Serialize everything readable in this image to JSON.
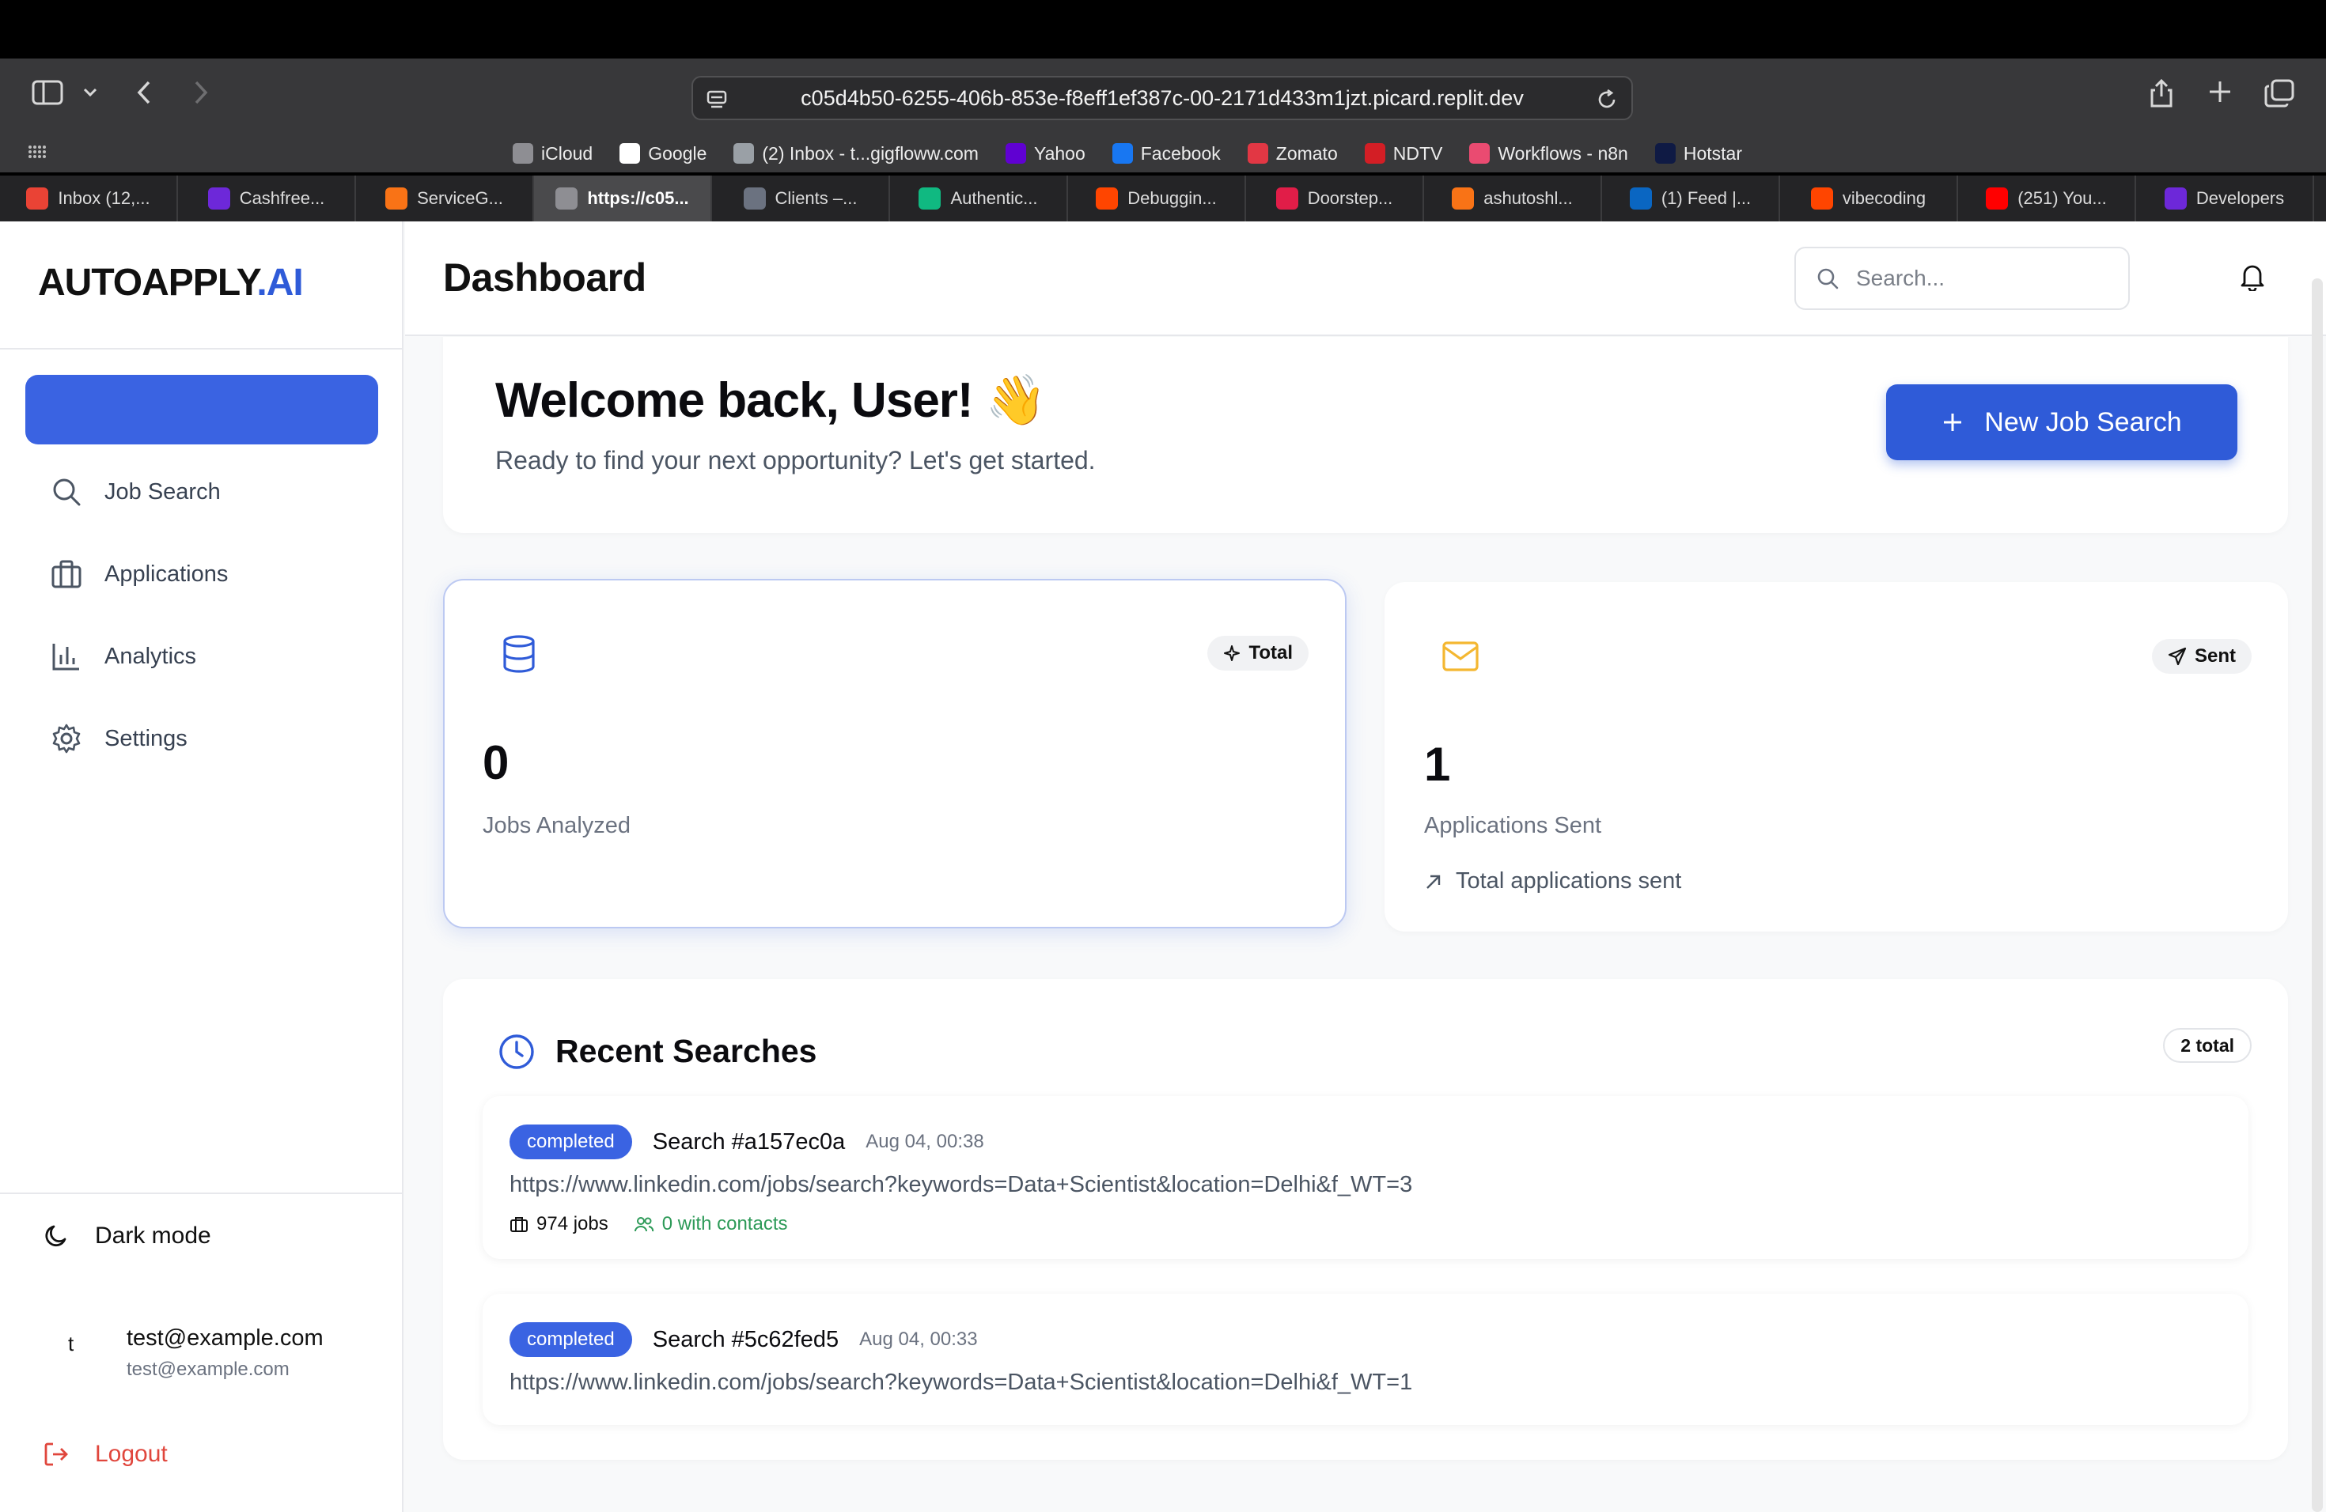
{
  "browser": {
    "url": "c05d4b50-6255-406b-853e-f8eff1ef387c-00-2171d433m1jzt.picard.replit.dev",
    "favorites": [
      {
        "label": "iCloud",
        "icon": "apple-icon",
        "color": "#8e8e93"
      },
      {
        "label": "Google",
        "icon": "google-icon",
        "color": "#ffffff"
      },
      {
        "label": "(2) Inbox - t...gigfloww.com",
        "icon": "chat-icon",
        "color": "#9aa0a6"
      },
      {
        "label": "Yahoo",
        "icon": "yahoo-icon",
        "color": "#6001d2"
      },
      {
        "label": "Facebook",
        "icon": "facebook-icon",
        "color": "#1877f2"
      },
      {
        "label": "Zomato",
        "icon": "zomato-icon",
        "color": "#e23744"
      },
      {
        "label": "NDTV",
        "icon": "ndtv-icon",
        "color": "#d31e25"
      },
      {
        "label": "Workflows - n8n",
        "icon": "n8n-icon",
        "color": "#ea4b71"
      },
      {
        "label": "Hotstar",
        "icon": "hotstar-icon",
        "color": "#0f1a44"
      }
    ],
    "tabs": [
      {
        "label": "Inbox (12,...",
        "icon": "gmail-icon",
        "color": "#ea4335",
        "active": false
      },
      {
        "label": "Cashfree...",
        "icon": "cashfree-icon",
        "color": "#6d28d9",
        "active": false
      },
      {
        "label": "ServiceG...",
        "icon": "servicegen-icon",
        "color": "#f97316",
        "active": false
      },
      {
        "label": "https://c05...",
        "icon": "replit-icon",
        "color": "#8e8e93",
        "active": true
      },
      {
        "label": "Clients –...",
        "icon": "clients-icon",
        "color": "#6b7280",
        "active": false
      },
      {
        "label": "Authentic...",
        "icon": "auth-icon",
        "color": "#10b981",
        "active": false
      },
      {
        "label": "Debuggin...",
        "icon": "reddit-icon",
        "color": "#ff4500",
        "active": false
      },
      {
        "label": "Doorstep...",
        "icon": "doorstep-icon",
        "color": "#e11d48",
        "active": false
      },
      {
        "label": "ashutoshl...",
        "icon": "servicegen-icon",
        "color": "#f97316",
        "active": false
      },
      {
        "label": "(1) Feed |...",
        "icon": "linkedin-icon",
        "color": "#0a66c2",
        "active": false
      },
      {
        "label": "vibecoding",
        "icon": "reddit-icon",
        "color": "#ff4500",
        "active": false
      },
      {
        "label": "(251) You...",
        "icon": "youtube-icon",
        "color": "#ff0000",
        "active": false
      },
      {
        "label": "Developers",
        "icon": "cashfree-icon",
        "color": "#6d28d9",
        "active": false
      }
    ]
  },
  "app": {
    "logo_main": "AUTOAPPLY",
    "logo_suffix": ".AI",
    "accent": "#3a63e2",
    "nav": [
      {
        "label": "Job Search",
        "icon": "search-icon"
      },
      {
        "label": "Applications",
        "icon": "briefcase-icon"
      },
      {
        "label": "Analytics",
        "icon": "bar-chart-icon"
      },
      {
        "label": "Settings",
        "icon": "gear-icon"
      }
    ],
    "dark_mode_label": "Dark mode",
    "user": {
      "initial": "t",
      "name": "test@example.com",
      "email": "test@example.com"
    },
    "logout_label": "Logout"
  },
  "header": {
    "title": "Dashboard",
    "search_placeholder": "Search..."
  },
  "welcome": {
    "title": "Welcome back, User! 👋",
    "subtitle": "Ready to find your next opportunity? Let's get started.",
    "button_label": "New Job Search"
  },
  "stats": [
    {
      "badge": "Total",
      "value": "0",
      "label": "Jobs Analyzed",
      "icon": "database-icon"
    },
    {
      "badge": "Sent",
      "value": "1",
      "label": "Applications Sent",
      "footnote": "Total applications sent",
      "icon": "mail-icon"
    }
  ],
  "recent": {
    "title": "Recent Searches",
    "total": "2 total",
    "items": [
      {
        "status": "completed",
        "id": "Search #a157ec0a",
        "date": "Aug 04, 00:38",
        "url": "https://www.linkedin.com/jobs/search?keywords=Data+Scientist&location=Delhi&f_WT=3",
        "jobs": "974 jobs",
        "contacts": "0 with contacts"
      },
      {
        "status": "completed",
        "id": "Search #5c62fed5",
        "date": "Aug 04, 00:33",
        "url": "https://www.linkedin.com/jobs/search?keywords=Data+Scientist&location=Delhi&f_WT=1"
      }
    ]
  }
}
